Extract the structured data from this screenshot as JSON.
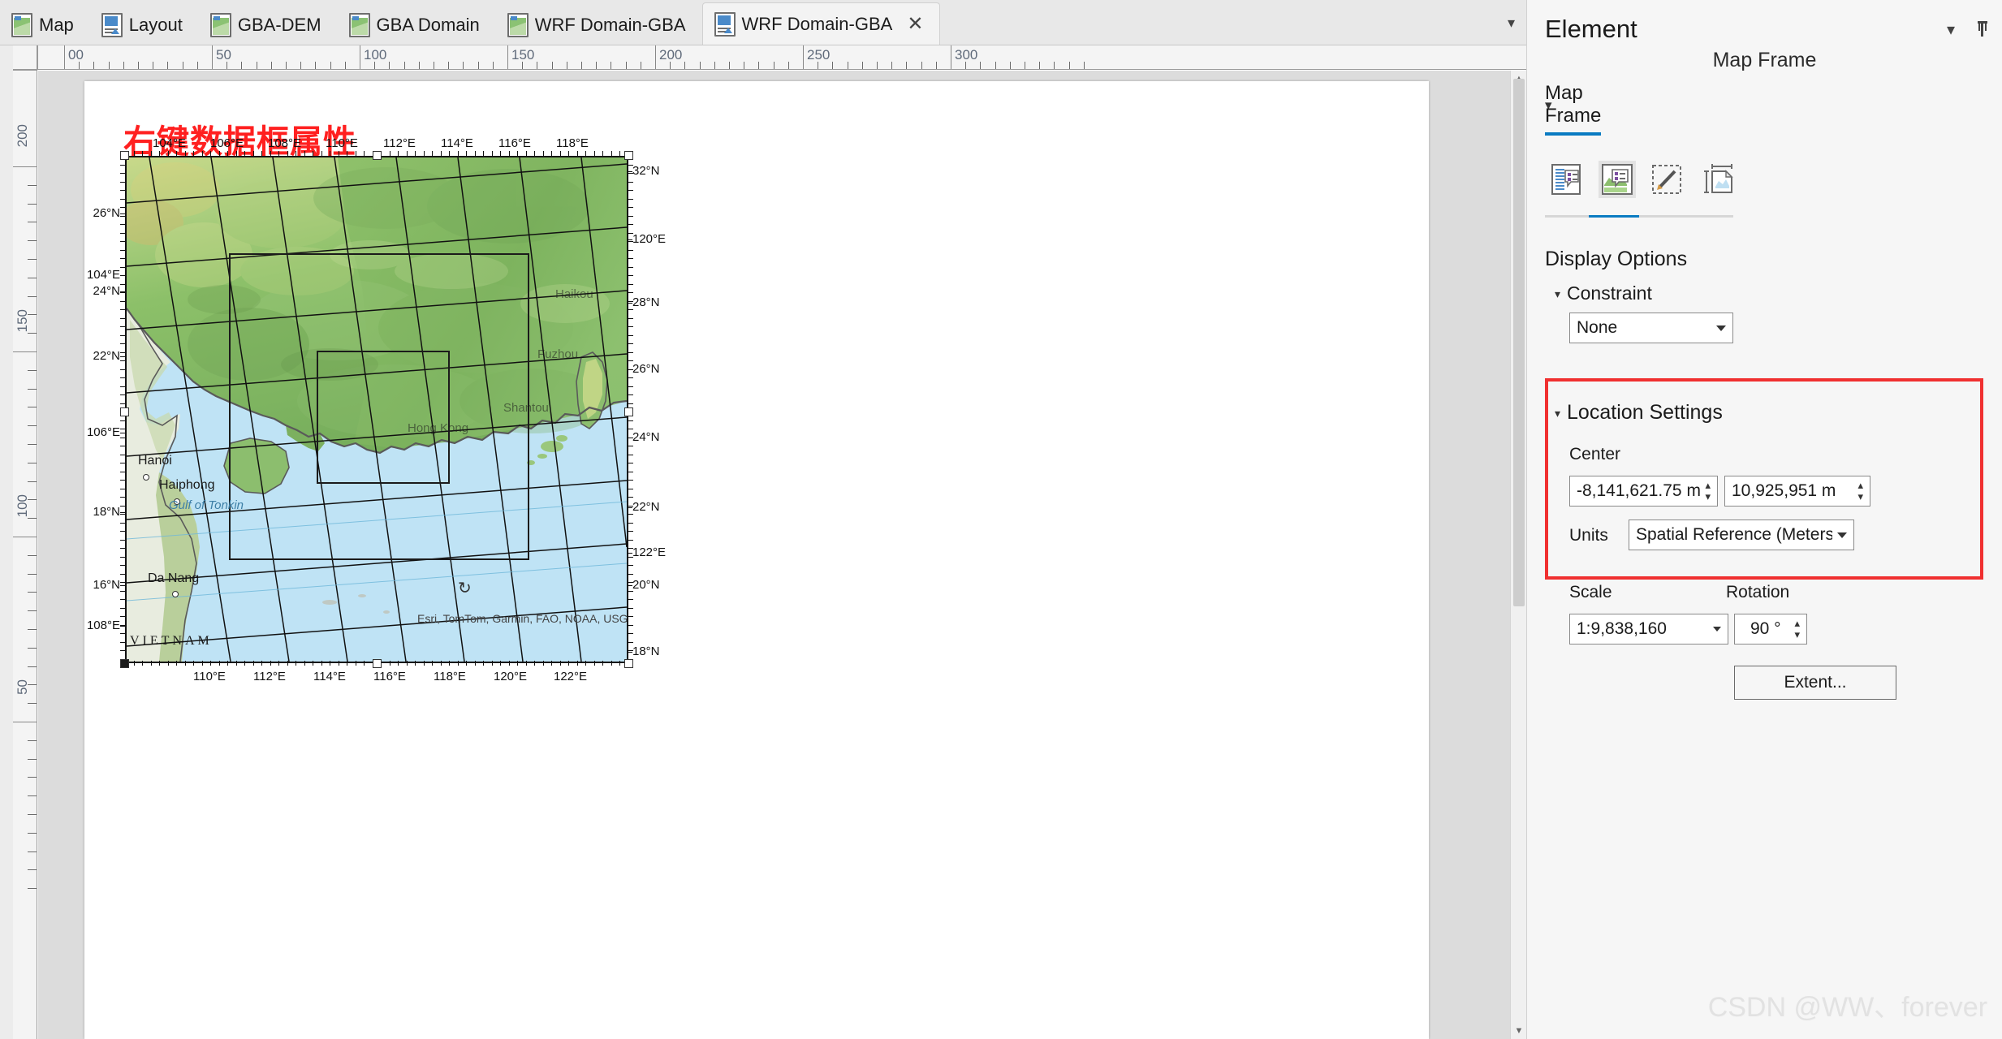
{
  "tabs": [
    {
      "label": "Map",
      "icon": "map-icon",
      "active": false,
      "closable": false
    },
    {
      "label": "Layout",
      "icon": "layout-icon",
      "active": false,
      "closable": false
    },
    {
      "label": "GBA-DEM",
      "icon": "map-icon",
      "active": false,
      "closable": false
    },
    {
      "label": "GBA Domain",
      "icon": "map-icon",
      "active": false,
      "closable": false
    },
    {
      "label": "WRF Domain-GBA",
      "icon": "map-icon",
      "active": false,
      "closable": false
    },
    {
      "label": "WRF Domain-GBA",
      "icon": "layout-icon",
      "active": true,
      "closable": true
    }
  ],
  "tab_overflow_icon": "chevron-down-icon",
  "tab_close_icon": "close-icon",
  "rulers": {
    "horizontal_labels": [
      "00",
      "50",
      "100",
      "150",
      "200",
      "250",
      "300"
    ],
    "vertical_labels": [
      "200",
      "150",
      "100",
      "50"
    ]
  },
  "canvas": {
    "annotation_text": "右键数据框属性",
    "annotation_color": "#ff2020"
  },
  "map": {
    "attribution": "Esri, TomTom, Garmin, FAO, NOAA, USGS, Esri, USGS",
    "top_labels": [
      "104°E",
      "106°E",
      "108°E",
      "110°E",
      "112°E",
      "114°E",
      "116°E",
      "118°E"
    ],
    "bottom_labels": [
      "110°E",
      "112°E",
      "114°E",
      "116°E",
      "118°E",
      "120°E",
      "122°E"
    ],
    "left_labels": [
      "26°N",
      "104°E",
      "24°N",
      "22°N",
      "106°E",
      "18°N",
      "16°N",
      "108°E"
    ],
    "right_labels": [
      "32°N",
      "120°E",
      "28°N",
      "26°N",
      "24°N",
      "22°N",
      "122°E",
      "20°N",
      "18°N"
    ],
    "cities": [
      "Hanoi",
      "Haiphong",
      "Da Nang"
    ],
    "faded_cities": [
      "Hong Kong",
      "Shantou",
      "Fuzhou",
      "Haikou"
    ],
    "country_label": "VIETNAM",
    "sea_label": "Gulf of Tonkin",
    "north_arrow_icon": "north-arrow-icon"
  },
  "panel": {
    "title": "Element",
    "collapse_icon": "chevron-down-icon",
    "pin_icon": "pin-icon",
    "element_type": "Map Frame",
    "subtab": {
      "label": "Map Frame",
      "dropdown_icon": "chevron-down-icon"
    },
    "icon_buttons": [
      {
        "name": "text-options-icon",
        "selected": false
      },
      {
        "name": "display-options-icon",
        "selected": true
      },
      {
        "name": "symbology-brush-icon",
        "selected": false
      },
      {
        "name": "placement-size-icon",
        "selected": false
      }
    ],
    "display_options": {
      "heading": "Display Options",
      "constraint": {
        "label": "Constraint",
        "value": "None",
        "caret_icon": "chevron-down-icon"
      }
    },
    "location_settings": {
      "heading": "Location Settings",
      "caret_icon": "chevron-down-icon",
      "highlight_color": "#f03030",
      "center_label": "Center",
      "center_x": "-8,141,621.75 m",
      "center_y": "10,925,951 m",
      "units_label": "Units",
      "units_value": "Spatial Reference (Meters)",
      "scale_label": "Scale",
      "scale_value": "1:9,838,160",
      "rotation_label": "Rotation",
      "rotation_value": "90 °",
      "extent_button": "Extent..."
    }
  },
  "watermark": "CSDN @WW、forever"
}
